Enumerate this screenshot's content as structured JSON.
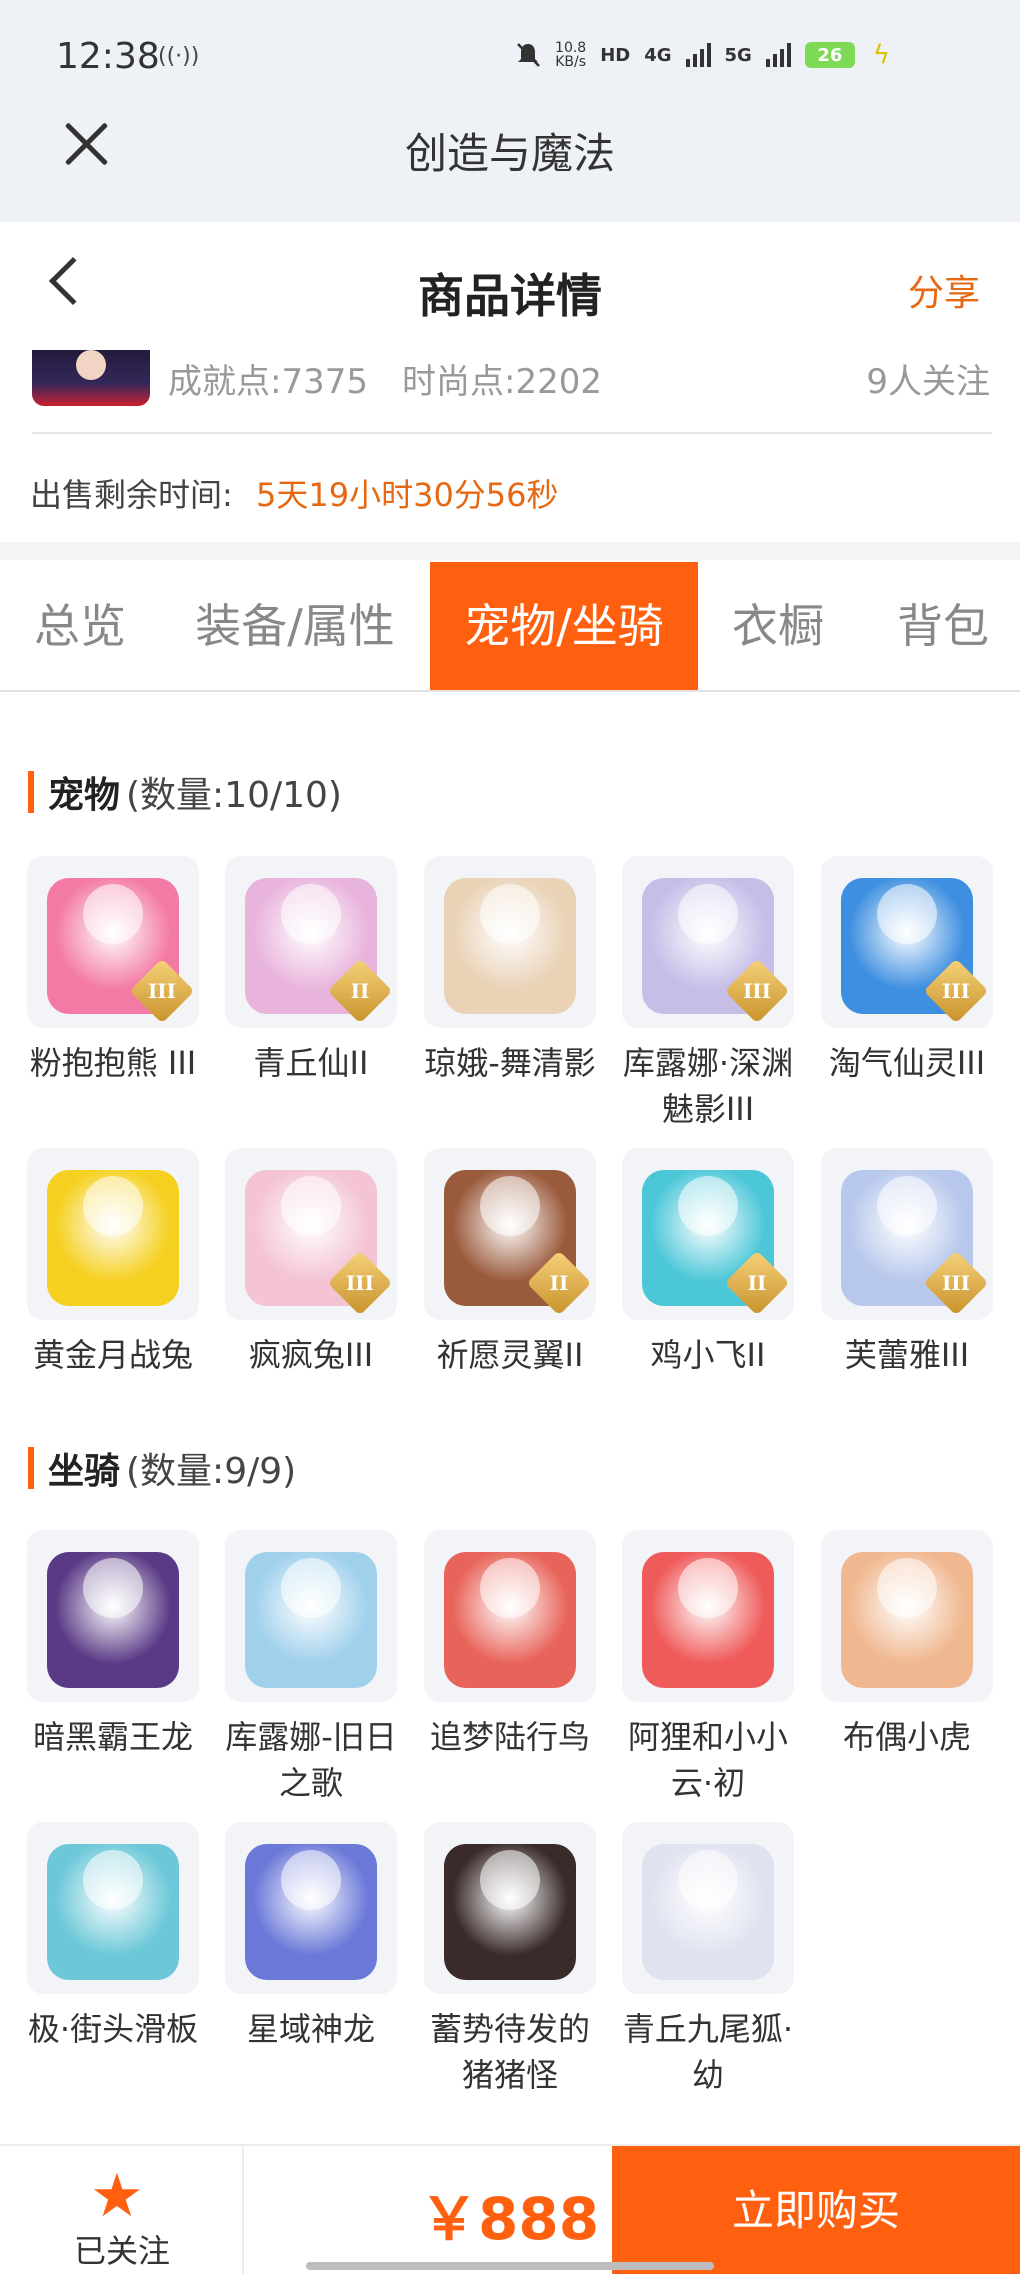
{
  "status_bar": {
    "time": "12:38",
    "wave": "((·))",
    "bell_icon": "bell-muted-icon",
    "net_speed_top": "10.8",
    "net_speed_bottom": "KB/s",
    "hd_label": "HD",
    "net1": "4G",
    "net2": "5G",
    "battery": "26"
  },
  "app_bar": {
    "title": "创造与魔法",
    "close_icon": "close-icon"
  },
  "header": {
    "title": "商品详情",
    "share_label": "分享",
    "back_icon": "chevron-left-icon"
  },
  "account": {
    "achievement": "成就点:7375",
    "fashion": "时尚点:2202",
    "followers": "9人关注",
    "sale_label": "出售剩余时间:",
    "sale_time": "5天19小时30分56秒"
  },
  "tabs": [
    {
      "label": "总览",
      "active": false
    },
    {
      "label": "装备/属性",
      "active": false
    },
    {
      "label": "宠物/坐骑",
      "active": true
    },
    {
      "label": "衣橱",
      "active": false
    },
    {
      "label": "背包",
      "active": false
    }
  ],
  "pets": {
    "title": "宠物",
    "count": "(数量:10/10)",
    "items": [
      {
        "name": "粉抱抱熊 III",
        "tier": "III",
        "color": "#f37aa5"
      },
      {
        "name": "青丘仙II",
        "tier": "II",
        "color": "#e9b4dc"
      },
      {
        "name": "琼娥-舞清影",
        "tier": "",
        "color": "#e9d2b6"
      },
      {
        "name": "库露娜·深渊魅影III",
        "tier": "III",
        "color": "#c7bee8"
      },
      {
        "name": "淘气仙灵III",
        "tier": "III",
        "color": "#3e8fe0"
      },
      {
        "name": "黄金月战兔",
        "tier": "",
        "color": "#f5d020"
      },
      {
        "name": "疯疯兔III",
        "tier": "III",
        "color": "#f4c4d4"
      },
      {
        "name": "祈愿灵翼II",
        "tier": "II",
        "color": "#9a5a3c"
      },
      {
        "name": "鸡小飞II",
        "tier": "II",
        "color": "#4cc7d8"
      },
      {
        "name": "芙蕾雅III",
        "tier": "III",
        "color": "#b8c8ec"
      }
    ]
  },
  "mounts": {
    "title": "坐骑",
    "count": "(数量:9/9)",
    "items": [
      {
        "name": "暗黑霸王龙",
        "tier": "",
        "color": "#5a3a86"
      },
      {
        "name": "库露娜-旧日之歌",
        "tier": "",
        "color": "#9fd0ec"
      },
      {
        "name": "追梦陆行鸟",
        "tier": "",
        "color": "#e8645a"
      },
      {
        "name": "阿狸和小小云·初",
        "tier": "",
        "color": "#ef5a5a"
      },
      {
        "name": "布偶小虎",
        "tier": "",
        "color": "#f0b890"
      },
      {
        "name": "极·街头滑板",
        "tier": "",
        "color": "#6cc8d8"
      },
      {
        "name": "星域神龙",
        "tier": "",
        "color": "#6a78d8"
      },
      {
        "name": "蓄势待发的猪猪怪",
        "tier": "",
        "color": "#3a2a2a"
      },
      {
        "name": "青丘九尾狐·幼",
        "tier": "",
        "color": "#e0e2f0"
      }
    ]
  },
  "bottom_bar": {
    "follow_label": "已关注",
    "star_icon": "star-icon",
    "price": "￥888",
    "buy_label": "立即购买"
  },
  "colors": {
    "accent": "#ff6010",
    "orange_text": "#e66812"
  }
}
